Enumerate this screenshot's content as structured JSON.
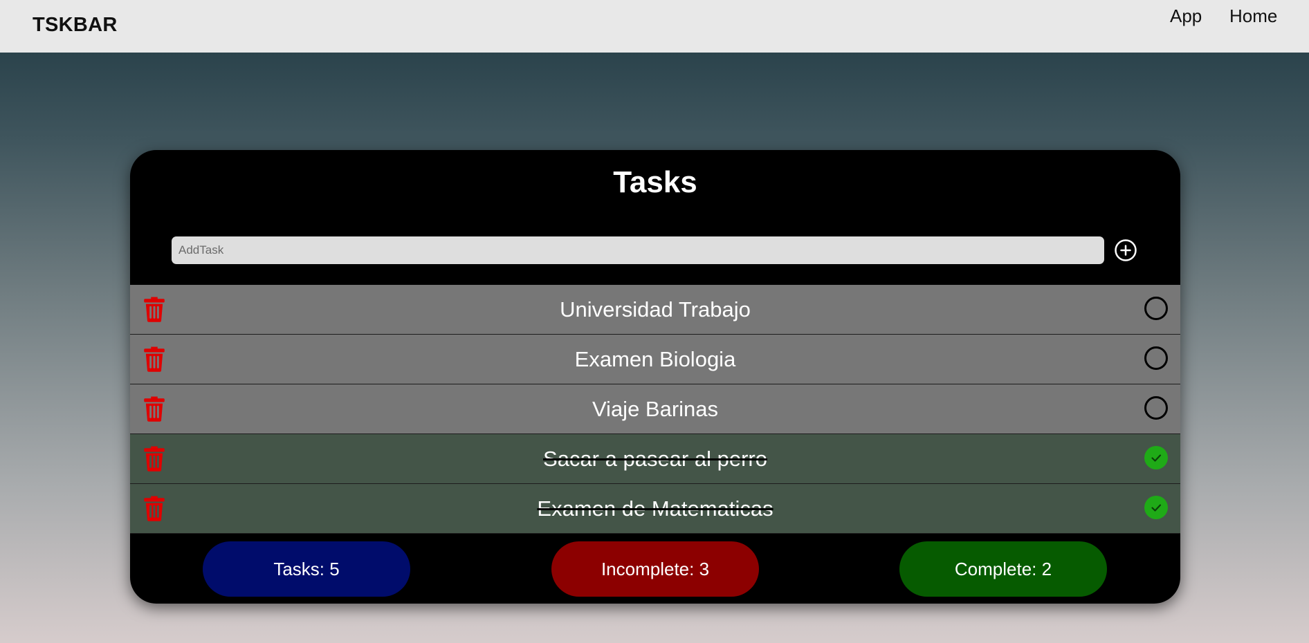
{
  "navbar": {
    "brand": "TSKBAR",
    "links": [
      "App",
      "Home"
    ]
  },
  "card": {
    "title": "Tasks",
    "input_placeholder": "AddTask",
    "tasks": [
      {
        "text": "Universidad Trabajo",
        "completed": false
      },
      {
        "text": "Examen Biologia",
        "completed": false
      },
      {
        "text": "Viaje Barinas",
        "completed": false
      },
      {
        "text": "Sacar a pasear al perro",
        "completed": true
      },
      {
        "text": "Examen de Matematicas",
        "completed": true
      }
    ],
    "stats": {
      "total": "Tasks: 5",
      "incomplete": "Incomplete: 3",
      "complete": "Complete: 2"
    }
  },
  "colors": {
    "delete_icon": "#e00000",
    "complete_check": "#1faa17",
    "incomplete_row": "#777777",
    "complete_row": "#445548",
    "tasks_badge": "#000c6b",
    "incomplete_badge": "#8c0000",
    "complete_badge": "#065b00"
  },
  "icons": {
    "add": "plus-circle-icon",
    "delete": "trash-icon",
    "incomplete": "empty-circle-icon",
    "complete": "check-circle-icon"
  }
}
